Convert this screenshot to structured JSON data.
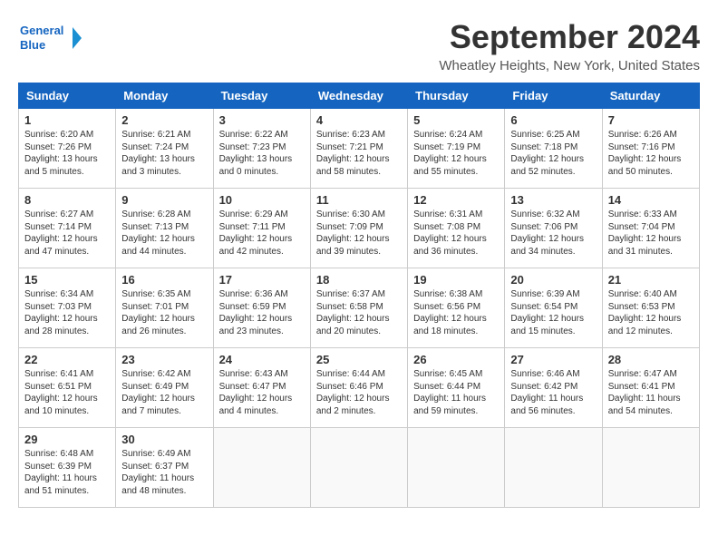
{
  "logo": {
    "line1": "General",
    "line2": "Blue"
  },
  "title": "September 2024",
  "location": "Wheatley Heights, New York, United States",
  "days_header": [
    "Sunday",
    "Monday",
    "Tuesday",
    "Wednesday",
    "Thursday",
    "Friday",
    "Saturday"
  ],
  "weeks": [
    [
      {
        "day": "1",
        "lines": [
          "Sunrise: 6:20 AM",
          "Sunset: 7:26 PM",
          "Daylight: 13 hours",
          "and 5 minutes."
        ]
      },
      {
        "day": "2",
        "lines": [
          "Sunrise: 6:21 AM",
          "Sunset: 7:24 PM",
          "Daylight: 13 hours",
          "and 3 minutes."
        ]
      },
      {
        "day": "3",
        "lines": [
          "Sunrise: 6:22 AM",
          "Sunset: 7:23 PM",
          "Daylight: 13 hours",
          "and 0 minutes."
        ]
      },
      {
        "day": "4",
        "lines": [
          "Sunrise: 6:23 AM",
          "Sunset: 7:21 PM",
          "Daylight: 12 hours",
          "and 58 minutes."
        ]
      },
      {
        "day": "5",
        "lines": [
          "Sunrise: 6:24 AM",
          "Sunset: 7:19 PM",
          "Daylight: 12 hours",
          "and 55 minutes."
        ]
      },
      {
        "day": "6",
        "lines": [
          "Sunrise: 6:25 AM",
          "Sunset: 7:18 PM",
          "Daylight: 12 hours",
          "and 52 minutes."
        ]
      },
      {
        "day": "7",
        "lines": [
          "Sunrise: 6:26 AM",
          "Sunset: 7:16 PM",
          "Daylight: 12 hours",
          "and 50 minutes."
        ]
      }
    ],
    [
      {
        "day": "8",
        "lines": [
          "Sunrise: 6:27 AM",
          "Sunset: 7:14 PM",
          "Daylight: 12 hours",
          "and 47 minutes."
        ]
      },
      {
        "day": "9",
        "lines": [
          "Sunrise: 6:28 AM",
          "Sunset: 7:13 PM",
          "Daylight: 12 hours",
          "and 44 minutes."
        ]
      },
      {
        "day": "10",
        "lines": [
          "Sunrise: 6:29 AM",
          "Sunset: 7:11 PM",
          "Daylight: 12 hours",
          "and 42 minutes."
        ]
      },
      {
        "day": "11",
        "lines": [
          "Sunrise: 6:30 AM",
          "Sunset: 7:09 PM",
          "Daylight: 12 hours",
          "and 39 minutes."
        ]
      },
      {
        "day": "12",
        "lines": [
          "Sunrise: 6:31 AM",
          "Sunset: 7:08 PM",
          "Daylight: 12 hours",
          "and 36 minutes."
        ]
      },
      {
        "day": "13",
        "lines": [
          "Sunrise: 6:32 AM",
          "Sunset: 7:06 PM",
          "Daylight: 12 hours",
          "and 34 minutes."
        ]
      },
      {
        "day": "14",
        "lines": [
          "Sunrise: 6:33 AM",
          "Sunset: 7:04 PM",
          "Daylight: 12 hours",
          "and 31 minutes."
        ]
      }
    ],
    [
      {
        "day": "15",
        "lines": [
          "Sunrise: 6:34 AM",
          "Sunset: 7:03 PM",
          "Daylight: 12 hours",
          "and 28 minutes."
        ]
      },
      {
        "day": "16",
        "lines": [
          "Sunrise: 6:35 AM",
          "Sunset: 7:01 PM",
          "Daylight: 12 hours",
          "and 26 minutes."
        ]
      },
      {
        "day": "17",
        "lines": [
          "Sunrise: 6:36 AM",
          "Sunset: 6:59 PM",
          "Daylight: 12 hours",
          "and 23 minutes."
        ]
      },
      {
        "day": "18",
        "lines": [
          "Sunrise: 6:37 AM",
          "Sunset: 6:58 PM",
          "Daylight: 12 hours",
          "and 20 minutes."
        ]
      },
      {
        "day": "19",
        "lines": [
          "Sunrise: 6:38 AM",
          "Sunset: 6:56 PM",
          "Daylight: 12 hours",
          "and 18 minutes."
        ]
      },
      {
        "day": "20",
        "lines": [
          "Sunrise: 6:39 AM",
          "Sunset: 6:54 PM",
          "Daylight: 12 hours",
          "and 15 minutes."
        ]
      },
      {
        "day": "21",
        "lines": [
          "Sunrise: 6:40 AM",
          "Sunset: 6:53 PM",
          "Daylight: 12 hours",
          "and 12 minutes."
        ]
      }
    ],
    [
      {
        "day": "22",
        "lines": [
          "Sunrise: 6:41 AM",
          "Sunset: 6:51 PM",
          "Daylight: 12 hours",
          "and 10 minutes."
        ]
      },
      {
        "day": "23",
        "lines": [
          "Sunrise: 6:42 AM",
          "Sunset: 6:49 PM",
          "Daylight: 12 hours",
          "and 7 minutes."
        ]
      },
      {
        "day": "24",
        "lines": [
          "Sunrise: 6:43 AM",
          "Sunset: 6:47 PM",
          "Daylight: 12 hours",
          "and 4 minutes."
        ]
      },
      {
        "day": "25",
        "lines": [
          "Sunrise: 6:44 AM",
          "Sunset: 6:46 PM",
          "Daylight: 12 hours",
          "and 2 minutes."
        ]
      },
      {
        "day": "26",
        "lines": [
          "Sunrise: 6:45 AM",
          "Sunset: 6:44 PM",
          "Daylight: 11 hours",
          "and 59 minutes."
        ]
      },
      {
        "day": "27",
        "lines": [
          "Sunrise: 6:46 AM",
          "Sunset: 6:42 PM",
          "Daylight: 11 hours",
          "and 56 minutes."
        ]
      },
      {
        "day": "28",
        "lines": [
          "Sunrise: 6:47 AM",
          "Sunset: 6:41 PM",
          "Daylight: 11 hours",
          "and 54 minutes."
        ]
      }
    ],
    [
      {
        "day": "29",
        "lines": [
          "Sunrise: 6:48 AM",
          "Sunset: 6:39 PM",
          "Daylight: 11 hours",
          "and 51 minutes."
        ]
      },
      {
        "day": "30",
        "lines": [
          "Sunrise: 6:49 AM",
          "Sunset: 6:37 PM",
          "Daylight: 11 hours",
          "and 48 minutes."
        ]
      },
      null,
      null,
      null,
      null,
      null
    ]
  ]
}
